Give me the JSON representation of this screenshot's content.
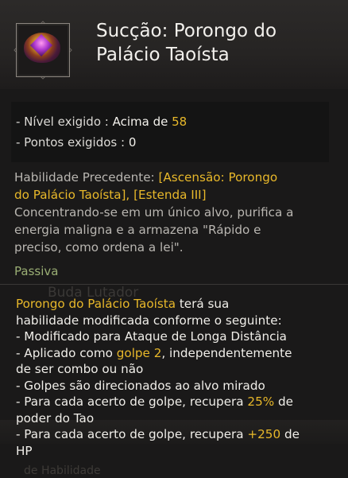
{
  "skill": {
    "title_line1": "Sucção: Porongo do",
    "title_line2": "Palácio Taoísta",
    "icon": "porongo-skill-icon"
  },
  "requirements": {
    "level_label": "- Nível exigido",
    "level_sep": " : ",
    "level_prefix": "Acima de ",
    "level_value": "58",
    "points_label": "- Pontos exigidos",
    "points_sep": " : ",
    "points_value": "0"
  },
  "description": {
    "prereq_label": "Habilidade Precedente: ",
    "prereq_line1_hl": "[Ascensão: Porongo",
    "prereq_line2_hl": "do Palácio Taoísta], [Estenda III]",
    "line3": "Concentrando-se em um único alvo, purifica a",
    "line4": "energia maligna e a armazena \"Rápido e",
    "line5": "preciso, como ordena a lei\"."
  },
  "passive_label": "Passiva",
  "background_ghost": {
    "text1": "Buda Lutador",
    "text3": "de Habilidade"
  },
  "effect": {
    "l1_hl": "Porongo do Palácio Taoísta",
    "l1_rest": " terá sua",
    "l2": "habilidade modificada conforme o seguinte:",
    "l3": "- Modificado para Ataque de Longa Distância",
    "l4_a": "- Aplicado como ",
    "l4_hl": "golpe 2",
    "l4_b": ", independentemente",
    "l5": "de ser combo ou não",
    "l6": "- Golpes são direcionados ao alvo mirado",
    "l7_a": "- Para cada acerto de golpe, recupera ",
    "l7_hl": "25%",
    "l7_b": " de",
    "l8": "poder do Tao",
    "l9_a": "- Para cada acerto de golpe, recupera ",
    "l9_hl": "+250",
    "l9_b": " de",
    "l10": "HP"
  },
  "colors": {
    "highlight": "#e8b82a",
    "passive": "#9aae74",
    "background": "#1a1919"
  }
}
